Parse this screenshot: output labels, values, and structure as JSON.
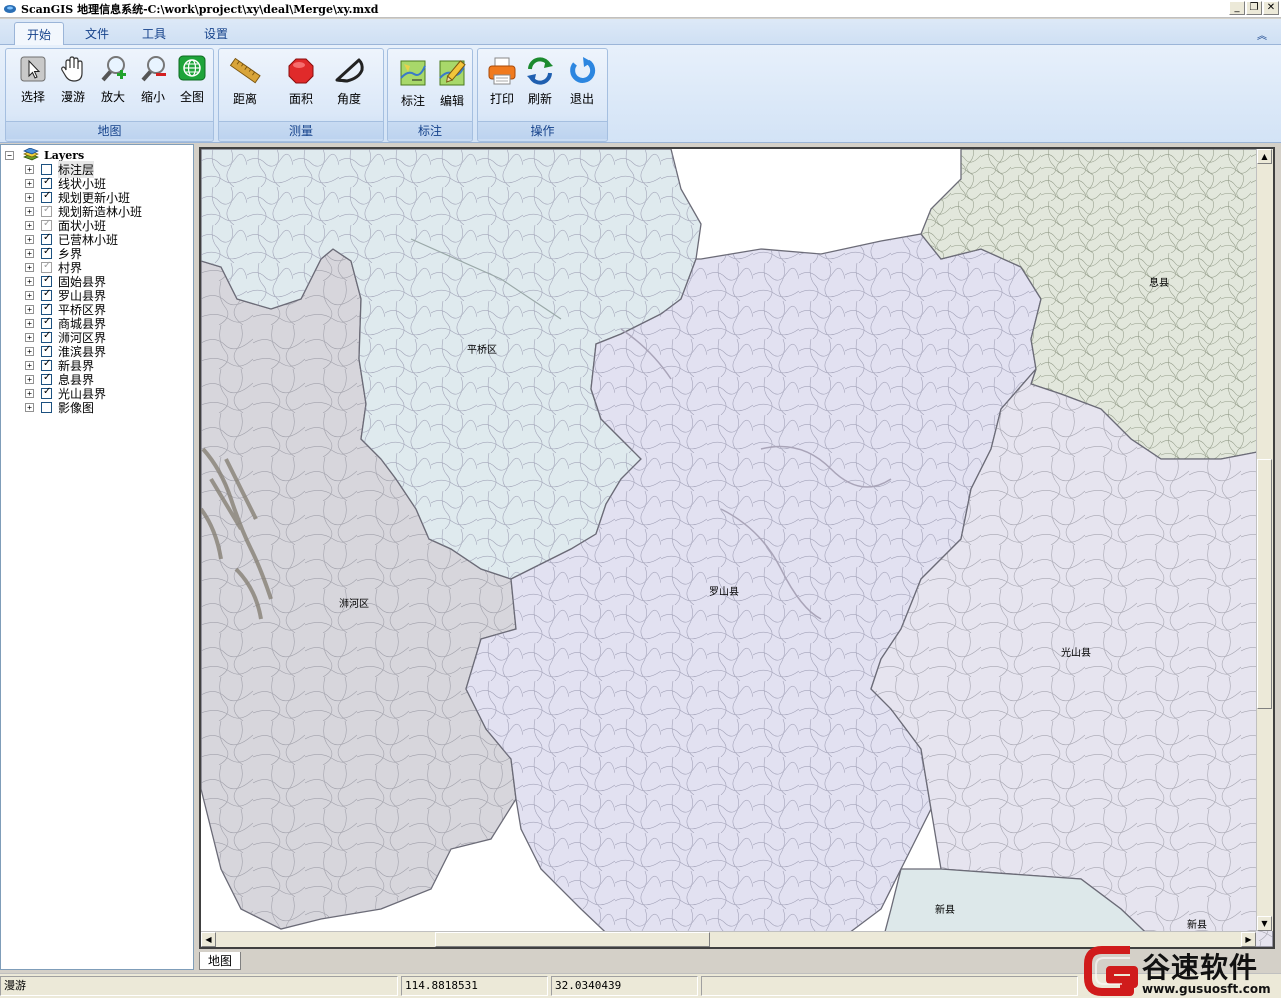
{
  "window": {
    "title": "ScanGIS 地理信息系统-C:\\work\\project\\xy\\deal\\Merge\\xy.mxd",
    "min_glyph": "_",
    "restore_glyph": "❐",
    "close_glyph": "✕"
  },
  "ribbon": {
    "tabs": [
      {
        "label": "开始",
        "active": true
      },
      {
        "label": "文件",
        "active": false
      },
      {
        "label": "工具",
        "active": false
      },
      {
        "label": "设置",
        "active": false
      }
    ],
    "collapse_glyph": "︽",
    "groups": [
      {
        "label": "地图",
        "buttons": [
          {
            "label": "选择",
            "icon": "arrow-pointer-icon"
          },
          {
            "label": "漫游",
            "icon": "hand-pan-icon"
          },
          {
            "label": "放大",
            "icon": "zoom-in-icon"
          },
          {
            "label": "缩小",
            "icon": "zoom-out-icon"
          },
          {
            "label": "全图",
            "icon": "globe-icon"
          }
        ]
      },
      {
        "label": "测量",
        "buttons": [
          {
            "label": "距离",
            "icon": "ruler-icon"
          },
          {
            "label": "面积",
            "icon": "octagon-area-icon"
          },
          {
            "label": "角度",
            "icon": "protractor-icon"
          }
        ]
      },
      {
        "label": "标注",
        "buttons": [
          {
            "label": "标注",
            "icon": "label-map-icon"
          },
          {
            "label": "编辑",
            "icon": "edit-map-icon"
          }
        ]
      },
      {
        "label": "操作",
        "buttons": [
          {
            "label": "打印",
            "icon": "printer-icon"
          },
          {
            "label": "刷新",
            "icon": "refresh-icon"
          },
          {
            "label": "退出",
            "icon": "exit-icon"
          }
        ]
      }
    ]
  },
  "layers": {
    "root_label": "Layers",
    "items": [
      {
        "name": "标注层",
        "checked": false,
        "gray": false,
        "selected": true
      },
      {
        "name": "线状小班",
        "checked": true,
        "gray": false
      },
      {
        "name": "规划更新小班",
        "checked": true,
        "gray": false
      },
      {
        "name": "规划新造林小班",
        "checked": true,
        "gray": true
      },
      {
        "name": "面状小班",
        "checked": true,
        "gray": true
      },
      {
        "name": "已营林小班",
        "checked": true,
        "gray": false
      },
      {
        "name": "乡界",
        "checked": true,
        "gray": false
      },
      {
        "name": "村界",
        "checked": true,
        "gray": true
      },
      {
        "name": "固始县界",
        "checked": true,
        "gray": false
      },
      {
        "name": "罗山县界",
        "checked": true,
        "gray": false
      },
      {
        "name": "平桥区界",
        "checked": true,
        "gray": false
      },
      {
        "name": "商城县界",
        "checked": true,
        "gray": false
      },
      {
        "name": "浉河区界",
        "checked": true,
        "gray": false
      },
      {
        "name": "淮滨县界",
        "checked": true,
        "gray": false
      },
      {
        "name": "新县界",
        "checked": true,
        "gray": false
      },
      {
        "name": "息县界",
        "checked": true,
        "gray": false
      },
      {
        "name": "光山县界",
        "checked": true,
        "gray": false
      },
      {
        "name": "影像图",
        "checked": false,
        "gray": false
      }
    ]
  },
  "map": {
    "labels": {
      "pingqiao": "平桥区",
      "luoshan": "罗山县",
      "shihe": "浉河区",
      "guangshan": "光山县",
      "xixian": "息县",
      "xinxian": "新县",
      "xinxian2": "新县"
    },
    "colors": {
      "pingqiao": "#dfeaee",
      "luoshan": "#e2e1f1",
      "shihe": "#d7d6dc",
      "guangshan": "#e6e4ef",
      "xixian": "#e2e7dc",
      "xinxian": "#dde8ea"
    },
    "tab_label": "地图"
  },
  "status": {
    "mode": "漫游",
    "lon": "114.8818531",
    "lat": "32.0340439"
  },
  "watermark": {
    "text": "谷速软件",
    "url": "www.gusuosft.com"
  },
  "colors": {
    "ribbon_text": "#15428b",
    "map_border": "#404040"
  }
}
